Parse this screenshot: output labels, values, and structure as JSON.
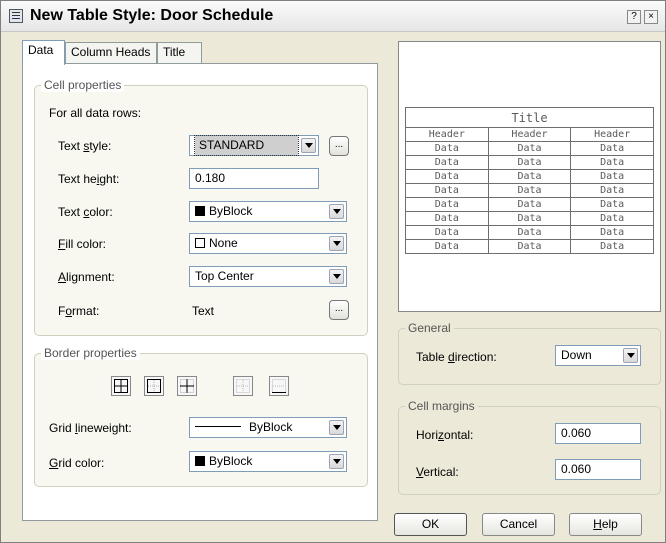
{
  "window": {
    "title": "New Table Style: Door Schedule",
    "help_glyph": "?",
    "close_glyph": "×"
  },
  "tabs": [
    {
      "label": "Data",
      "active": true
    },
    {
      "label": "Column Heads",
      "active": false
    },
    {
      "label": "Title",
      "active": false
    }
  ],
  "cell_properties": {
    "legend": "Cell properties",
    "for_all_label": "For all data rows:",
    "text_style": {
      "pre": "Text ",
      "key": "s",
      "post": "tyle:",
      "value": "STANDARD",
      "browse": "..."
    },
    "text_height": {
      "pre": "Text he",
      "key": "i",
      "post": "ght:",
      "value": "0.180"
    },
    "text_color": {
      "pre": "Text ",
      "key": "c",
      "post": "olor:",
      "value": "ByBlock",
      "swatch_color": "#000000"
    },
    "fill_color": {
      "pre": "",
      "key": "F",
      "post": "ill color:",
      "value": "None",
      "swatch_color": "#ffffff"
    },
    "alignment": {
      "pre": "",
      "key": "A",
      "post": "lignment:",
      "value": "Top Center"
    },
    "format": {
      "pre": "F",
      "key": "o",
      "post": "rmat:",
      "value": "Text",
      "browse": "..."
    }
  },
  "border_properties": {
    "legend": "Border properties",
    "buttons": [
      "all-borders",
      "outside-borders",
      "inside-borders",
      "no-borders",
      "bottom-border"
    ],
    "grid_lineweight": {
      "pre": "Grid ",
      "key": "l",
      "post": "ineweight:",
      "value": "ByBlock"
    },
    "grid_color": {
      "pre": "",
      "key": "G",
      "post": "rid color:",
      "value": "ByBlock",
      "swatch_color": "#000000"
    }
  },
  "preview": {
    "title": "Title",
    "headers": [
      "Header",
      "Header",
      "Header"
    ],
    "row_cell": "Data",
    "rows": 8
  },
  "general": {
    "legend": "General",
    "table_direction": {
      "pre": "Table ",
      "key": "d",
      "post": "irection:",
      "value": "Down"
    }
  },
  "cell_margins": {
    "legend": "Cell margins",
    "horizontal": {
      "pre": "Hori",
      "key": "z",
      "post": "ontal:",
      "value": "0.060"
    },
    "vertical": {
      "pre": "",
      "key": "V",
      "post": "ertical:",
      "value": "0.060"
    }
  },
  "buttons": {
    "ok": "OK",
    "cancel": "Cancel",
    "help_key": "H",
    "help_rest": "elp"
  }
}
